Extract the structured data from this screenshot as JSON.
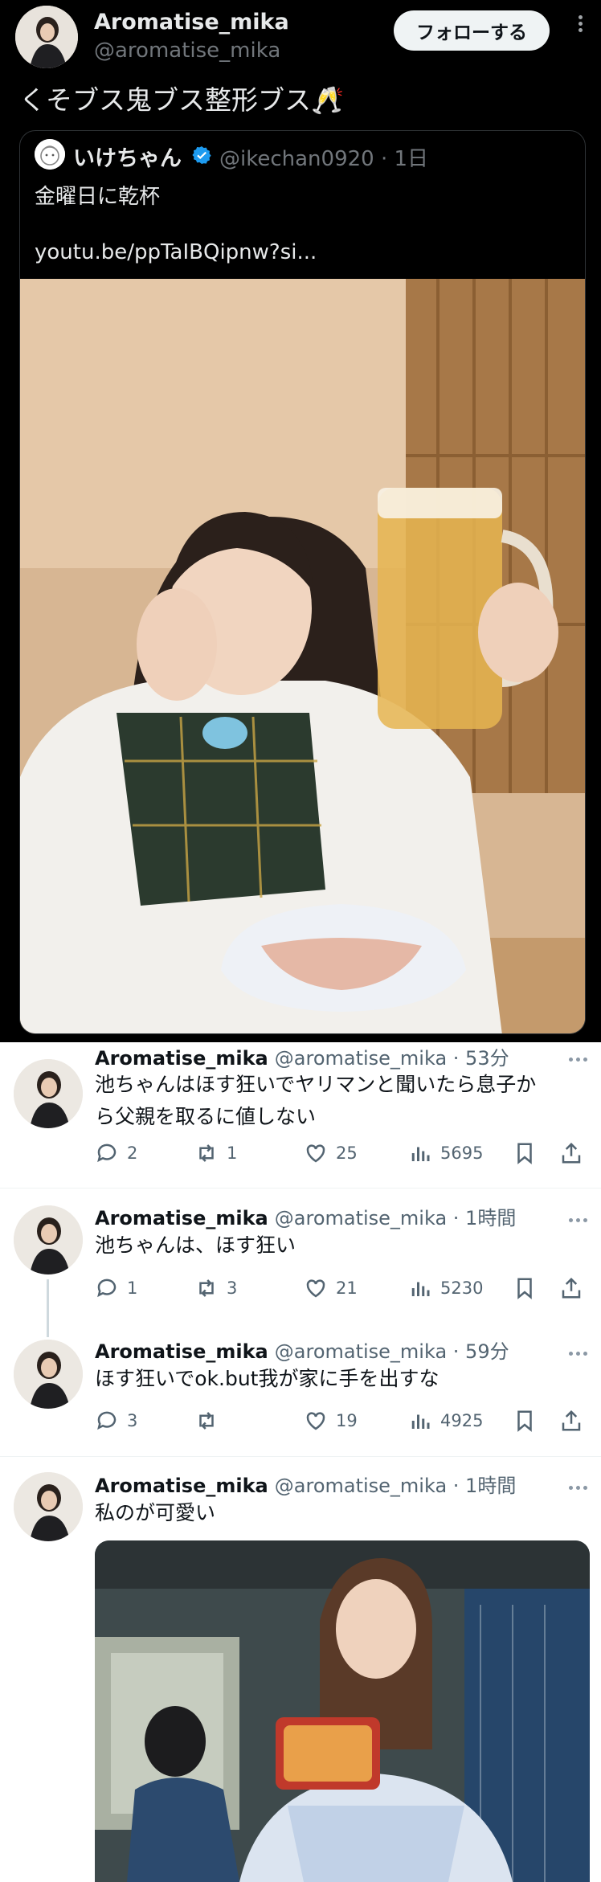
{
  "header": {
    "display_name": "Aromatise_mika",
    "handle": "@aromatise_mika",
    "follow_label": "フォローする"
  },
  "main_post": {
    "text": "くそブス鬼ブス整形ブス🥂"
  },
  "quoted": {
    "display_name": "いけちゃん",
    "meta": "@ikechan0920 · 1日",
    "body": "金曜日に乾杯",
    "link": "youtu.be/ppTaIBQipnw?si..."
  },
  "replies": [
    {
      "display_name": "Aromatise_mika",
      "meta": "@aromatise_mika · 53分",
      "line1": "池ちゃんはほす狂いでヤリマンと聞いたら息子か",
      "line2": "ら父親を取るに値しない",
      "replies": "2",
      "reposts": "1",
      "likes": "25",
      "views": "5695"
    },
    {
      "display_name": "Aromatise_mika",
      "meta": "@aromatise_mika · 1時間",
      "line1": "池ちゃんは、ほす狂い",
      "replies": "1",
      "reposts": "3",
      "likes": "21",
      "views": "5230"
    },
    {
      "display_name": "Aromatise_mika",
      "meta": "@aromatise_mika · 59分",
      "line1": "ほす狂いでok.but我が家に手を出すな",
      "replies": "3",
      "reposts": "",
      "likes": "19",
      "views": "4925"
    },
    {
      "display_name": "Aromatise_mika",
      "meta": "@aromatise_mika · 1時間",
      "line1": "私のが可愛い"
    }
  ],
  "icons": {
    "reply": "speech-bubble-icon",
    "repost": "repost-arrows-icon",
    "like": "heart-icon",
    "views": "bar-chart-icon",
    "bookmark": "bookmark-icon",
    "share": "share-upload-icon"
  },
  "colors": {
    "dark_bg": "#000000",
    "light_bg": "#ffffff",
    "verified": "#1d9bf0",
    "muted": "#536471"
  }
}
